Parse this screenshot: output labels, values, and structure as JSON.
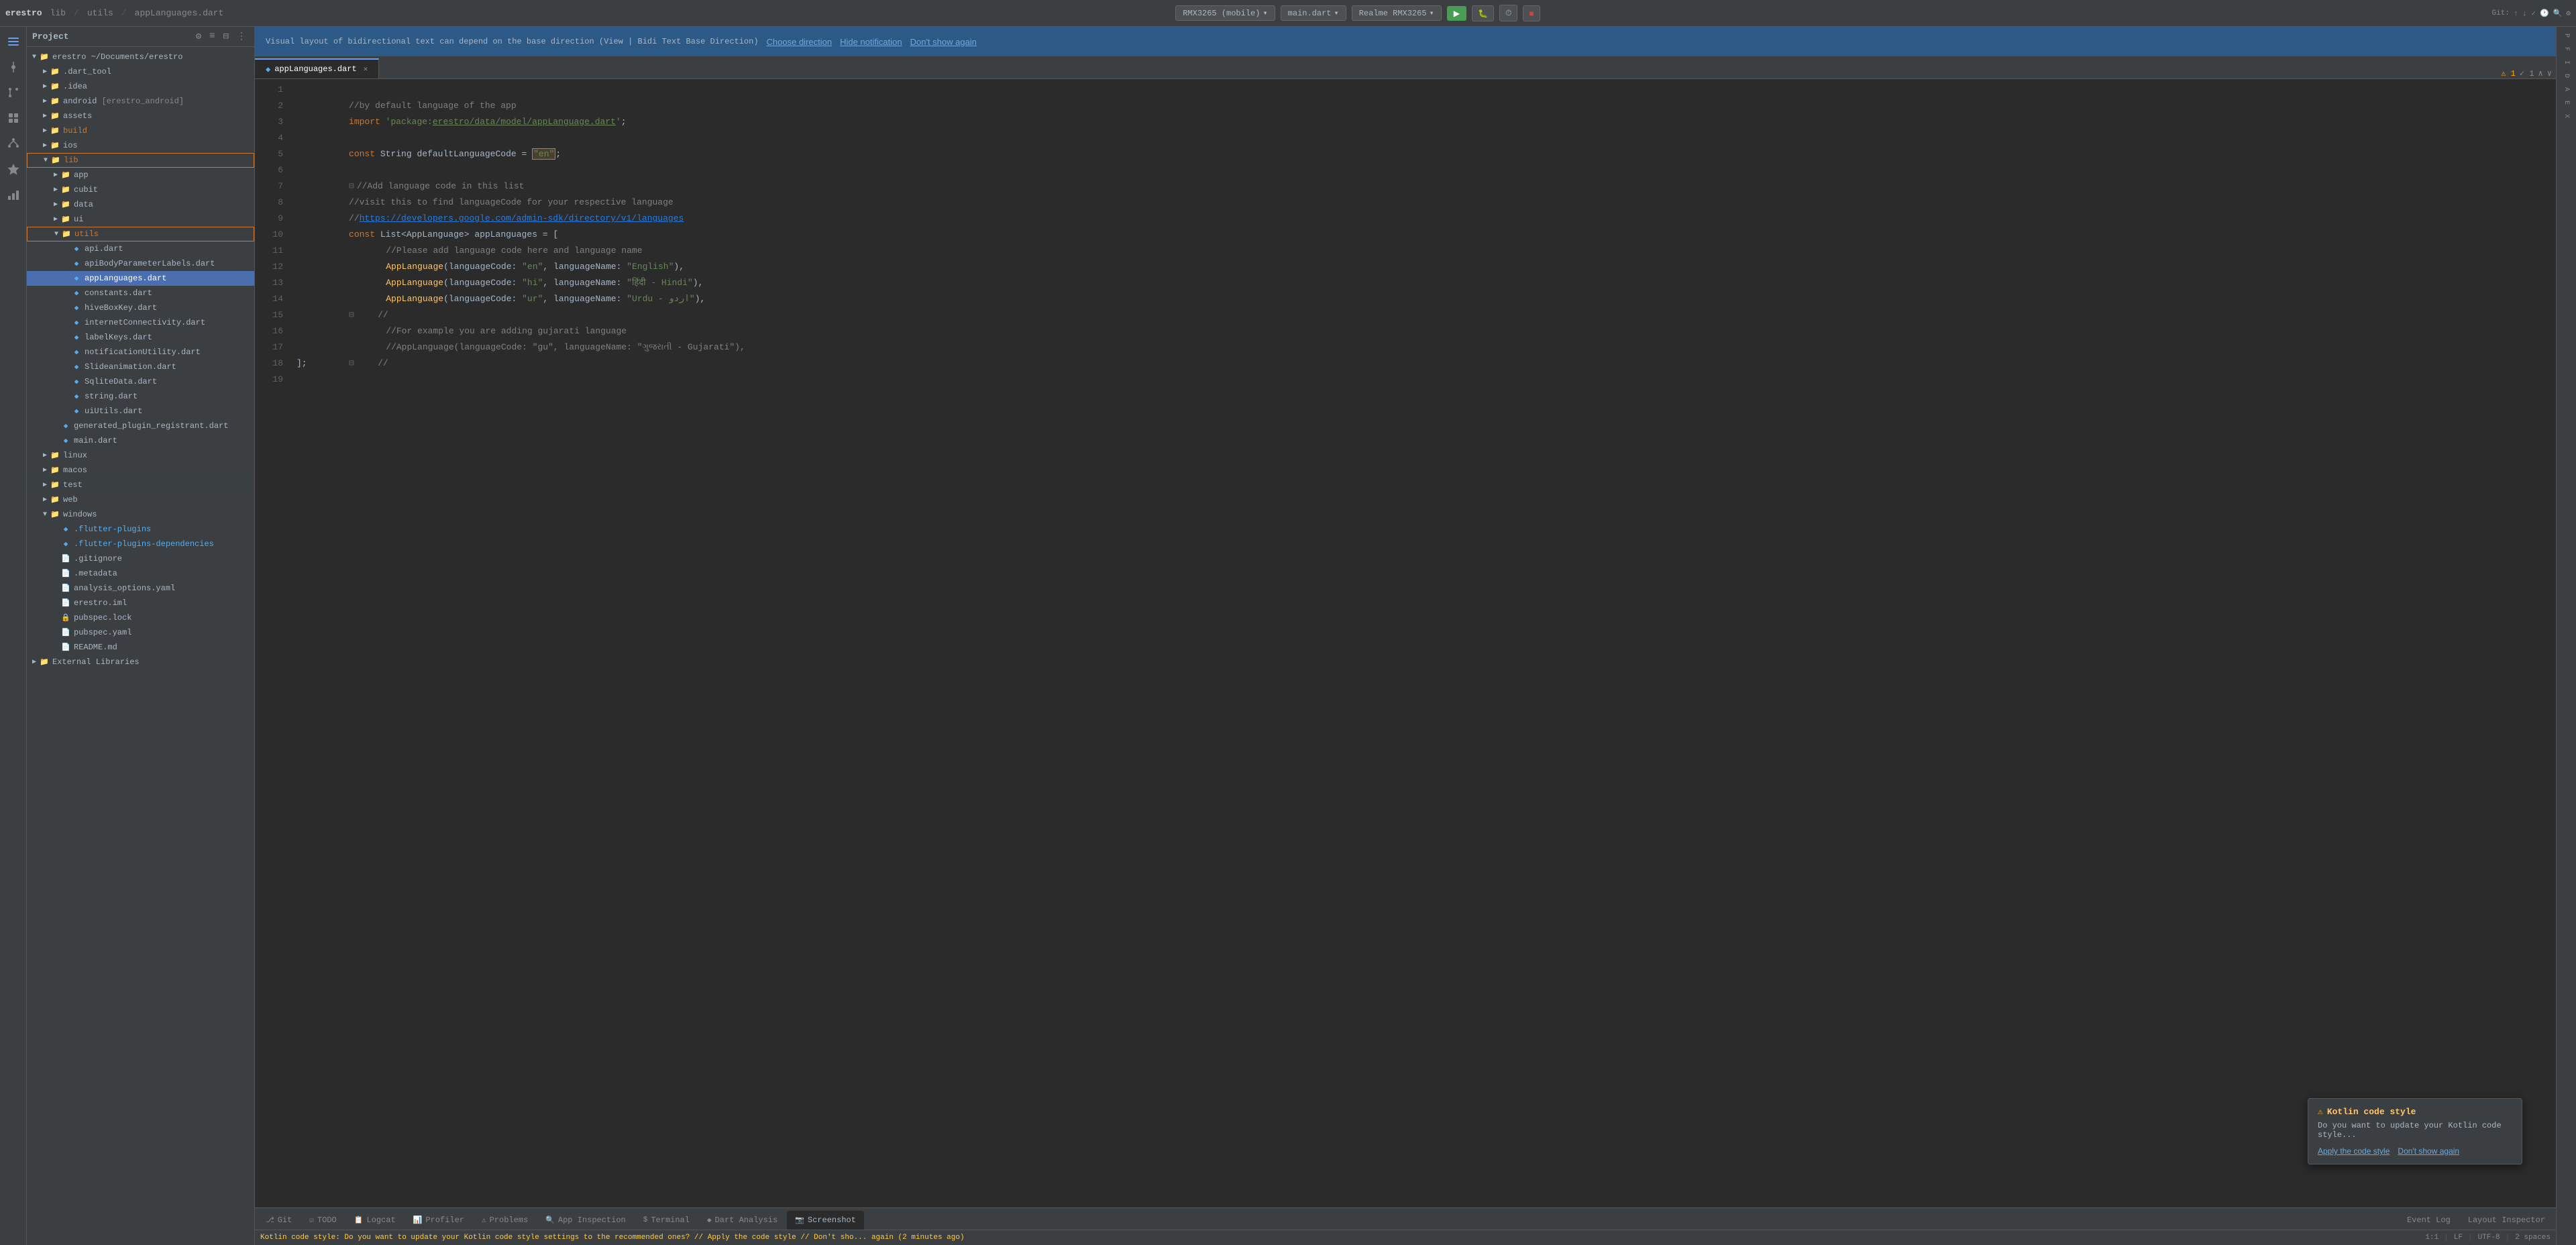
{
  "app": {
    "title": "erestro"
  },
  "topbar": {
    "breadcrumb": "erestro / lib / utils / appLanguages.dart",
    "file_tab": "appLanguages.dart",
    "device_label": "RMX3265 (mobile)",
    "file_label": "main.dart",
    "device_model": "Realme RMX3265",
    "git_label": "Git:",
    "run_label": "▶",
    "dont_show_again": "Don't show again"
  },
  "notification": {
    "text": "Visual layout of bidirectional text can depend on the base direction (View | Bidi Text Base Direction)",
    "choose_direction": "Choose direction",
    "hide_notification": "Hide notification",
    "dont_show_again": "Don't show again"
  },
  "file_tree": {
    "root": "erestro ~/Documents/erestro",
    "items": [
      {
        "id": "dart_tool",
        "label": ".dart_tool",
        "type": "folder",
        "depth": 1,
        "expanded": false
      },
      {
        "id": "idea",
        "label": ".idea",
        "type": "folder",
        "depth": 1,
        "expanded": false
      },
      {
        "id": "android",
        "label": "android [erestro_android]",
        "type": "folder",
        "depth": 1,
        "expanded": false
      },
      {
        "id": "assets",
        "label": "assets",
        "type": "folder",
        "depth": 1,
        "expanded": false
      },
      {
        "id": "build",
        "label": "build",
        "type": "folder",
        "depth": 1,
        "expanded": false
      },
      {
        "id": "ios",
        "label": "ios",
        "type": "folder",
        "depth": 1,
        "expanded": false
      },
      {
        "id": "lib",
        "label": "lib",
        "type": "folder",
        "depth": 1,
        "expanded": true
      },
      {
        "id": "app",
        "label": "app",
        "type": "folder",
        "depth": 2,
        "expanded": false
      },
      {
        "id": "cubit",
        "label": "cubit",
        "type": "folder",
        "depth": 2,
        "expanded": false
      },
      {
        "id": "data",
        "label": "data",
        "type": "folder",
        "depth": 2,
        "expanded": false
      },
      {
        "id": "ui",
        "label": "ui",
        "type": "folder",
        "depth": 2,
        "expanded": false
      },
      {
        "id": "utils",
        "label": "utils",
        "type": "folder",
        "depth": 2,
        "expanded": true
      },
      {
        "id": "api_dart",
        "label": "api.dart",
        "type": "dart",
        "depth": 3
      },
      {
        "id": "apibody_dart",
        "label": "apiBodyParameterLabels.dart",
        "type": "dart",
        "depth": 3
      },
      {
        "id": "applang_dart",
        "label": "appLanguages.dart",
        "type": "dart",
        "depth": 3,
        "selected": true
      },
      {
        "id": "constants_dart",
        "label": "constants.dart",
        "type": "dart",
        "depth": 3
      },
      {
        "id": "hiveboxkey_dart",
        "label": "hiveBoxKey.dart",
        "type": "dart",
        "depth": 3
      },
      {
        "id": "internetconn_dart",
        "label": "internetConnectivity.dart",
        "type": "dart",
        "depth": 3
      },
      {
        "id": "labelkeys_dart",
        "label": "labelKeys.dart",
        "type": "dart",
        "depth": 3
      },
      {
        "id": "notifutil_dart",
        "label": "notificationUtility.dart",
        "type": "dart",
        "depth": 3
      },
      {
        "id": "slideani_dart",
        "label": "Slideanimation.dart",
        "type": "dart",
        "depth": 3
      },
      {
        "id": "sqlitedata_dart",
        "label": "SqliteData.dart",
        "type": "dart",
        "depth": 3
      },
      {
        "id": "string_dart",
        "label": "string.dart",
        "type": "dart",
        "depth": 3
      },
      {
        "id": "uiutils_dart",
        "label": "uiUtils.dart",
        "type": "dart",
        "depth": 3
      },
      {
        "id": "generated_plugin",
        "label": "generated_plugin_registrant.dart",
        "type": "dart",
        "depth": 2
      },
      {
        "id": "main_dart",
        "label": "main.dart",
        "type": "dart",
        "depth": 2
      },
      {
        "id": "linux",
        "label": "linux",
        "type": "folder",
        "depth": 1,
        "expanded": false
      },
      {
        "id": "macos",
        "label": "macos",
        "type": "folder",
        "depth": 1,
        "expanded": false
      },
      {
        "id": "test",
        "label": "test",
        "type": "folder",
        "depth": 1,
        "expanded": false
      },
      {
        "id": "web",
        "label": "web",
        "type": "folder",
        "depth": 1,
        "expanded": false
      },
      {
        "id": "windows",
        "label": "windows",
        "type": "folder",
        "depth": 1,
        "expanded": true
      },
      {
        "id": "flutter_plugins",
        "label": ".flutter-plugins",
        "type": "file",
        "depth": 2
      },
      {
        "id": "flutter_plugins_dep",
        "label": ".flutter-plugins-dependencies",
        "type": "file",
        "depth": 2
      },
      {
        "id": "gitignore",
        "label": ".gitignore",
        "type": "file",
        "depth": 2
      },
      {
        "id": "metadata",
        "label": ".metadata",
        "type": "file",
        "depth": 2
      },
      {
        "id": "analysis_opt",
        "label": "analysis_options.yaml",
        "type": "yaml",
        "depth": 2
      },
      {
        "id": "erestro_iml",
        "label": "erestro.iml",
        "type": "iml",
        "depth": 2
      },
      {
        "id": "pubspec_lock",
        "label": "pubspec.lock",
        "type": "lock",
        "depth": 2
      },
      {
        "id": "pubspec_yaml",
        "label": "pubspec.yaml",
        "type": "yaml",
        "depth": 2
      },
      {
        "id": "readme_md",
        "label": "README.md",
        "type": "txt",
        "depth": 2
      },
      {
        "id": "ext_libs",
        "label": "External Libraries",
        "type": "folder",
        "depth": 0,
        "expanded": false
      }
    ]
  },
  "editor": {
    "tab_name": "appLanguages.dart",
    "lines": [
      {
        "num": 1,
        "content": "//by default language of the app"
      },
      {
        "num": 2,
        "content": "import 'package:erestro/data/model/appLanguage.dart';"
      },
      {
        "num": 3,
        "content": ""
      },
      {
        "num": 4,
        "content": "const String defaultLanguageCode = \"en\";"
      },
      {
        "num": 5,
        "content": ""
      },
      {
        "num": 6,
        "content": "//Add language code in this list"
      },
      {
        "num": 7,
        "content": "//visit this to find languageCode for your respective language"
      },
      {
        "num": 8,
        "content": "//https://developers.google.com/admin-sdk/directory/v1/languages"
      },
      {
        "num": 9,
        "content": "const List<AppLanguage> appLanguages = ["
      },
      {
        "num": 10,
        "content": "    //Please add language code here and language name"
      },
      {
        "num": 11,
        "content": "    AppLanguage(languageCode: \"en\", languageName: \"English\"),"
      },
      {
        "num": 12,
        "content": "    AppLanguage(languageCode: \"hi\", languageName: \"हिंदी - Hindi\"),"
      },
      {
        "num": 13,
        "content": "    AppLanguage(languageCode: \"ur\", languageName: \"Urdu - اردو\"),"
      },
      {
        "num": 14,
        "content": "    //"
      },
      {
        "num": 15,
        "content": "    //For example you are adding gujarati language"
      },
      {
        "num": 16,
        "content": "    //AppLanguage(languageCode: \"gu\", languageName: \"ગુજરાતી - Gujarati\"),"
      },
      {
        "num": 17,
        "content": "    //"
      },
      {
        "num": 18,
        "content": "];"
      },
      {
        "num": 19,
        "content": ""
      }
    ],
    "cursor": {
      "line": 1,
      "col": 1
    },
    "encoding": "UTF-8",
    "indent": "2 spaces"
  },
  "bottom_tabs": [
    {
      "id": "git",
      "label": "Git",
      "icon": "⎇",
      "active": false
    },
    {
      "id": "todo",
      "label": "TODO",
      "icon": "☑",
      "active": false
    },
    {
      "id": "logcat",
      "label": "Logcat",
      "icon": "📋",
      "active": false
    },
    {
      "id": "profiler",
      "label": "Profiler",
      "icon": "📊",
      "active": false
    },
    {
      "id": "problems",
      "label": "Problems",
      "icon": "⚠",
      "active": false
    },
    {
      "id": "app_inspection",
      "label": "App Inspection",
      "icon": "🔍",
      "active": false
    },
    {
      "id": "terminal",
      "label": "Terminal",
      "icon": "$",
      "active": false
    },
    {
      "id": "dart_analysis",
      "label": "Dart Analysis",
      "icon": "◆",
      "active": false
    },
    {
      "id": "screenshot",
      "label": "Screenshot",
      "icon": "📷",
      "active": false
    }
  ],
  "status_bar": {
    "message": "Kotlin code style: Do you want to update your Kotlin code style settings to the recommended ones? // Apply the code style // Don't sho... again (2 minutes ago)",
    "position": "1:1",
    "lf": "LF",
    "encoding": "UTF-8",
    "indent": "2 spaces",
    "event_log": "Event Log",
    "layout_inspector": "Layout Inspector"
  },
  "kotlin_popup": {
    "title": "Kotlin code style",
    "text": "Do you want to update your Kotlin code style...",
    "apply_label": "Apply the code style",
    "dont_show_label": "Don't show again"
  },
  "right_sidebar": {
    "items": [
      "Performance",
      "Flutter Outline",
      "Flutter Inspector",
      "Device Manager",
      "ADB Wi-Fi",
      "Emulator",
      "Device File Explorer"
    ]
  },
  "icons": {
    "warning": "⚠",
    "dart": "◆",
    "folder": "📁",
    "arrow_right": "▶",
    "arrow_down": "▼",
    "close": "✕",
    "settings": "⚙",
    "a1_warning": "A 1",
    "v1_warning": "✓ 1"
  }
}
